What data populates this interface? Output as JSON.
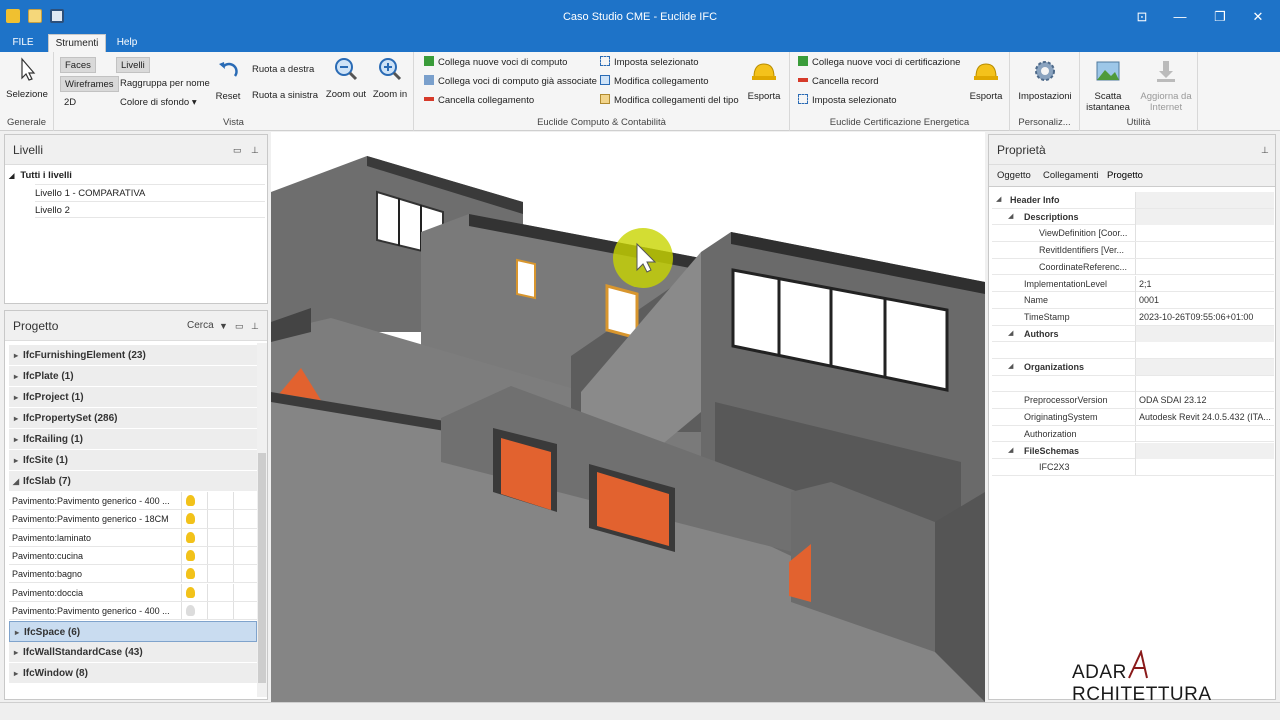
{
  "window": {
    "title": "Caso Studio CME - Euclide IFC"
  },
  "menu_tabs": [
    "FILE",
    "Strumenti",
    "Help"
  ],
  "ribbon": {
    "generale": {
      "label": "Generale",
      "selezione": "Selezione"
    },
    "vista": {
      "label": "Vista",
      "faces": "Faces",
      "wireframes": "Wireframes",
      "d2": "2D",
      "livelli": "Livelli",
      "raggruppa": "Raggruppa per nome",
      "colore": "Colore di sfondo",
      "reset": "Reset",
      "ruota_destra": "Ruota a destra",
      "ruota_sinistra": "Ruota a sinistra",
      "zoom_out": "Zoom out",
      "zoom_in": "Zoom in"
    },
    "computo": {
      "label": "Euclide Computo & Contabilità",
      "collega_nuove": "Collega nuove voci di computo",
      "collega_associate": "Collega voci di computo già associate",
      "cancella_collegamento": "Cancella collegamento",
      "imposta_selezionato": "Imposta selezionato",
      "modifica_collegamento": "Modifica collegamento",
      "modifica_tipo": "Modifica collegamenti del tipo",
      "esporta": "Esporta"
    },
    "certificazione": {
      "label": "Euclide Certificazione Energetica",
      "collega_cert": "Collega nuove voci di certificazione",
      "cancella_record": "Cancella record",
      "imposta_selezionato": "Imposta selezionato",
      "esporta": "Esporta"
    },
    "personaliz": {
      "label": "Personaliz...",
      "impostazioni": "Impostazioni"
    },
    "utilita": {
      "label": "Utilità",
      "scatta": "Scatta istantanea",
      "aggiorna": "Aggiorna da Internet"
    }
  },
  "livelli_panel": {
    "title": "Livelli",
    "root": "Tutti i livelli",
    "items": [
      "Livello 1 - COMPARATIVA",
      "Livello 2"
    ]
  },
  "progetto_panel": {
    "title": "Progetto",
    "cerca": "Cerca",
    "groups_top": [
      "IfcFurnishingElement (23)",
      "IfcPlate (1)",
      "IfcProject (1)",
      "IfcPropertySet (286)",
      "IfcRailing (1)",
      "IfcSite (1)",
      "IfcSlab (7)"
    ],
    "slabs": [
      "Pavimento:Pavimento generico - 400 ...",
      "Pavimento:Pavimento generico - 18CM",
      "Pavimento:laminato",
      "Pavimento:cucina",
      "Pavimento:bagno",
      "Pavimento:doccia",
      "Pavimento:Pavimento generico - 400 ..."
    ],
    "groups_bottom": [
      "IfcSpace (6)",
      "IfcWallStandardCase (43)",
      "IfcWindow (8)"
    ]
  },
  "proprieta_panel": {
    "title": "Proprietà",
    "tabs": [
      "Oggetto",
      "Collegamenti",
      "Progetto"
    ],
    "rows": [
      {
        "key": "Header Info",
        "value": "",
        "level": 0,
        "cat": true
      },
      {
        "key": "Descriptions",
        "value": "",
        "level": 1,
        "cat": true
      },
      {
        "key": "ViewDefinition [Coor...",
        "value": "",
        "level": 2,
        "cat": false
      },
      {
        "key": "RevitIdentifiers [Ver...",
        "value": "",
        "level": 2,
        "cat": false
      },
      {
        "key": "CoordinateReferenc...",
        "value": "",
        "level": 2,
        "cat": false
      },
      {
        "key": "ImplementationLevel",
        "value": "2;1",
        "level": 1,
        "cat": false
      },
      {
        "key": "Name",
        "value": "0001",
        "level": 1,
        "cat": false
      },
      {
        "key": "TimeStamp",
        "value": "2023-10-26T09:55:06+01:00",
        "level": 1,
        "cat": false
      },
      {
        "key": "Authors",
        "value": "",
        "level": 1,
        "cat": true
      },
      {
        "key": "",
        "value": "",
        "level": 2,
        "cat": false
      },
      {
        "key": "Organizations",
        "value": "",
        "level": 1,
        "cat": true
      },
      {
        "key": "",
        "value": "",
        "level": 2,
        "cat": false
      },
      {
        "key": "PreprocessorVersion",
        "value": "ODA SDAI 23.12",
        "level": 1,
        "cat": false
      },
      {
        "key": "OriginatingSystem",
        "value": "Autodesk Revit 24.0.5.432 (ITA...",
        "level": 1,
        "cat": false
      },
      {
        "key": "Authorization",
        "value": "",
        "level": 1,
        "cat": false
      },
      {
        "key": "FileSchemas",
        "value": "",
        "level": 1,
        "cat": true
      },
      {
        "key": "IFC2X3",
        "value": "",
        "level": 2,
        "cat": false
      }
    ]
  },
  "watermark": {
    "left": "ADAR",
    "right": "RCHITETTURA"
  },
  "colors": {
    "titlebar": "#1e73c8",
    "wall": "#6b6b6b",
    "door": "#e2622f",
    "cursor": "#c8d400"
  }
}
